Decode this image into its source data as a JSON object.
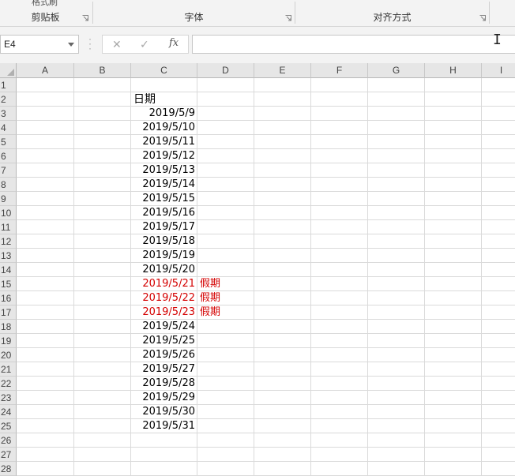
{
  "ribbon": {
    "groups": [
      {
        "label": "剪贴板"
      },
      {
        "label": "字体"
      },
      {
        "label": "对齐方式"
      }
    ],
    "partial_button_label": "格式刷"
  },
  "formula_bar": {
    "name_box": "E4",
    "cancel_icon": "close-icon",
    "enter_icon": "check-icon",
    "fx_label": "fx",
    "formula_value": ""
  },
  "sheet": {
    "columns": [
      "A",
      "B",
      "C",
      "D",
      "E",
      "F",
      "G",
      "H",
      "I"
    ],
    "rows": [
      "1",
      "2",
      "3",
      "4",
      "5",
      "6",
      "7",
      "8",
      "9",
      "10",
      "11",
      "12",
      "13",
      "14",
      "15",
      "16",
      "17",
      "18",
      "19",
      "20",
      "21",
      "22",
      "23",
      "24",
      "25",
      "26",
      "27",
      "28"
    ],
    "header_cell": {
      "row": 2,
      "col": "C",
      "value": "日期"
    },
    "dates": [
      "2019/5/9",
      "2019/5/10",
      "2019/5/11",
      "2019/5/12",
      "2019/5/13",
      "2019/5/14",
      "2019/5/15",
      "2019/5/16",
      "2019/5/17",
      "2019/5/18",
      "2019/5/19",
      "2019/5/20",
      "2019/5/21",
      "2019/5/22",
      "2019/5/23",
      "2019/5/24",
      "2019/5/25",
      "2019/5/26",
      "2019/5/27",
      "2019/5/28",
      "2019/5/29",
      "2019/5/30",
      "2019/5/31"
    ],
    "holiday_rows": [
      15,
      16,
      17
    ],
    "holiday_label": "假期",
    "holiday_color": "#d40000"
  }
}
